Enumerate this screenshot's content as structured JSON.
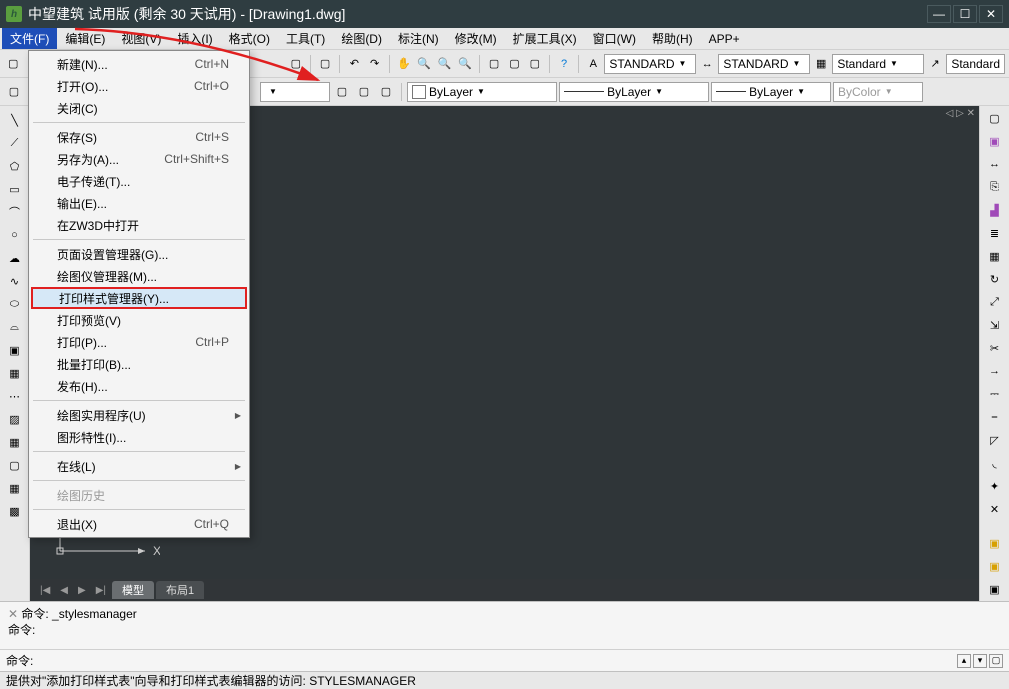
{
  "title": "中望建筑 试用版 (剩余 30 天试用)  - [Drawing1.dwg]",
  "menubar": [
    "文件(F)",
    "编辑(E)",
    "视图(V)",
    "插入(I)",
    "格式(O)",
    "工具(T)",
    "绘图(D)",
    "标注(N)",
    "修改(M)",
    "扩展工具(X)",
    "窗口(W)",
    "帮助(H)",
    "APP+"
  ],
  "toolbar1": {
    "std1": "STANDARD",
    "std2": "STANDARD",
    "std3": "Standard",
    "std4": "Standard"
  },
  "toolbar2": {
    "layer": "ByLayer",
    "linetype": "ByLayer",
    "lineweight": "ByLayer",
    "color": "ByColor"
  },
  "file_menu": [
    {
      "label": "新建(N)...",
      "sc": "Ctrl+N"
    },
    {
      "label": "打开(O)...",
      "sc": "Ctrl+O"
    },
    {
      "label": "关闭(C)"
    },
    {
      "sep": true
    },
    {
      "label": "保存(S)",
      "sc": "Ctrl+S"
    },
    {
      "label": "另存为(A)...",
      "sc": "Ctrl+Shift+S"
    },
    {
      "label": "电子传递(T)..."
    },
    {
      "label": "输出(E)..."
    },
    {
      "label": "在ZW3D中打开"
    },
    {
      "sep": true
    },
    {
      "label": "页面设置管理器(G)..."
    },
    {
      "label": "绘图仪管理器(M)..."
    },
    {
      "label": "打印样式管理器(Y)...",
      "hl": true
    },
    {
      "label": "打印预览(V)"
    },
    {
      "label": "打印(P)...",
      "sc": "Ctrl+P"
    },
    {
      "label": "批量打印(B)..."
    },
    {
      "label": "发布(H)..."
    },
    {
      "sep": true
    },
    {
      "label": "绘图实用程序(U)",
      "sub": true
    },
    {
      "label": "图形特性(I)..."
    },
    {
      "sep": true
    },
    {
      "label": "在线(L)",
      "sub": true
    },
    {
      "sep": true
    },
    {
      "label": "绘图历史",
      "disabled": true
    },
    {
      "sep": true
    },
    {
      "label": "退出(X)",
      "sc": "Ctrl+Q"
    }
  ],
  "tabs": {
    "model": "模型",
    "layout": "布局1"
  },
  "cmd": {
    "log1": "命令:  _stylesmanager",
    "log2": "命令:",
    "prompt": "命令:",
    "closex": "×"
  },
  "status": "提供对\"添加打印样式表\"向导和打印样式表编辑器的访问:   STYLESMANAGER",
  "axis_x": "X",
  "nav": "◁ ▷ ✕"
}
